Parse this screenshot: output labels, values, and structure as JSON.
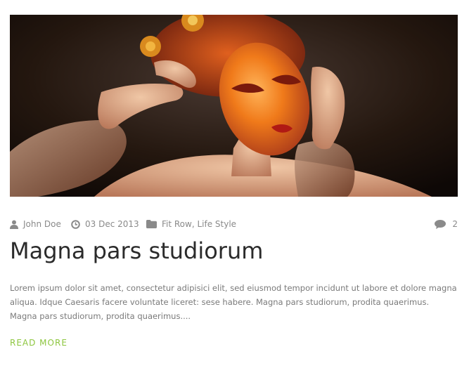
{
  "post": {
    "image_alt": "Woman with orange fantasy face paint and flowers in hair",
    "meta": {
      "author": "John Doe",
      "date": "03 Dec 2013",
      "categories_sep": ", ",
      "categories": [
        "Fit Row",
        "Life Style"
      ],
      "comments_count": "2"
    },
    "title": "Magna pars studiorum",
    "excerpt": "Lorem ipsum dolor sit amet, consectetur adipisici elit, sed eiusmod tempor incidunt ut labore et dolore magna aliqua. Idque Caesaris facere voluntate liceret: sese habere. Magna pars studiorum, prodita quaerimus. Magna pars studiorum, prodita quaerimus....",
    "read_more_label": "READ MORE"
  },
  "colors": {
    "accent": "#8dc63f",
    "meta_text": "#8a8a8a",
    "title_text": "#2b2b2b",
    "excerpt_text": "#7a7a7a"
  },
  "icons": {
    "author": "user-icon",
    "date": "clock-icon",
    "categories": "folder-icon",
    "comments": "comment-icon"
  }
}
